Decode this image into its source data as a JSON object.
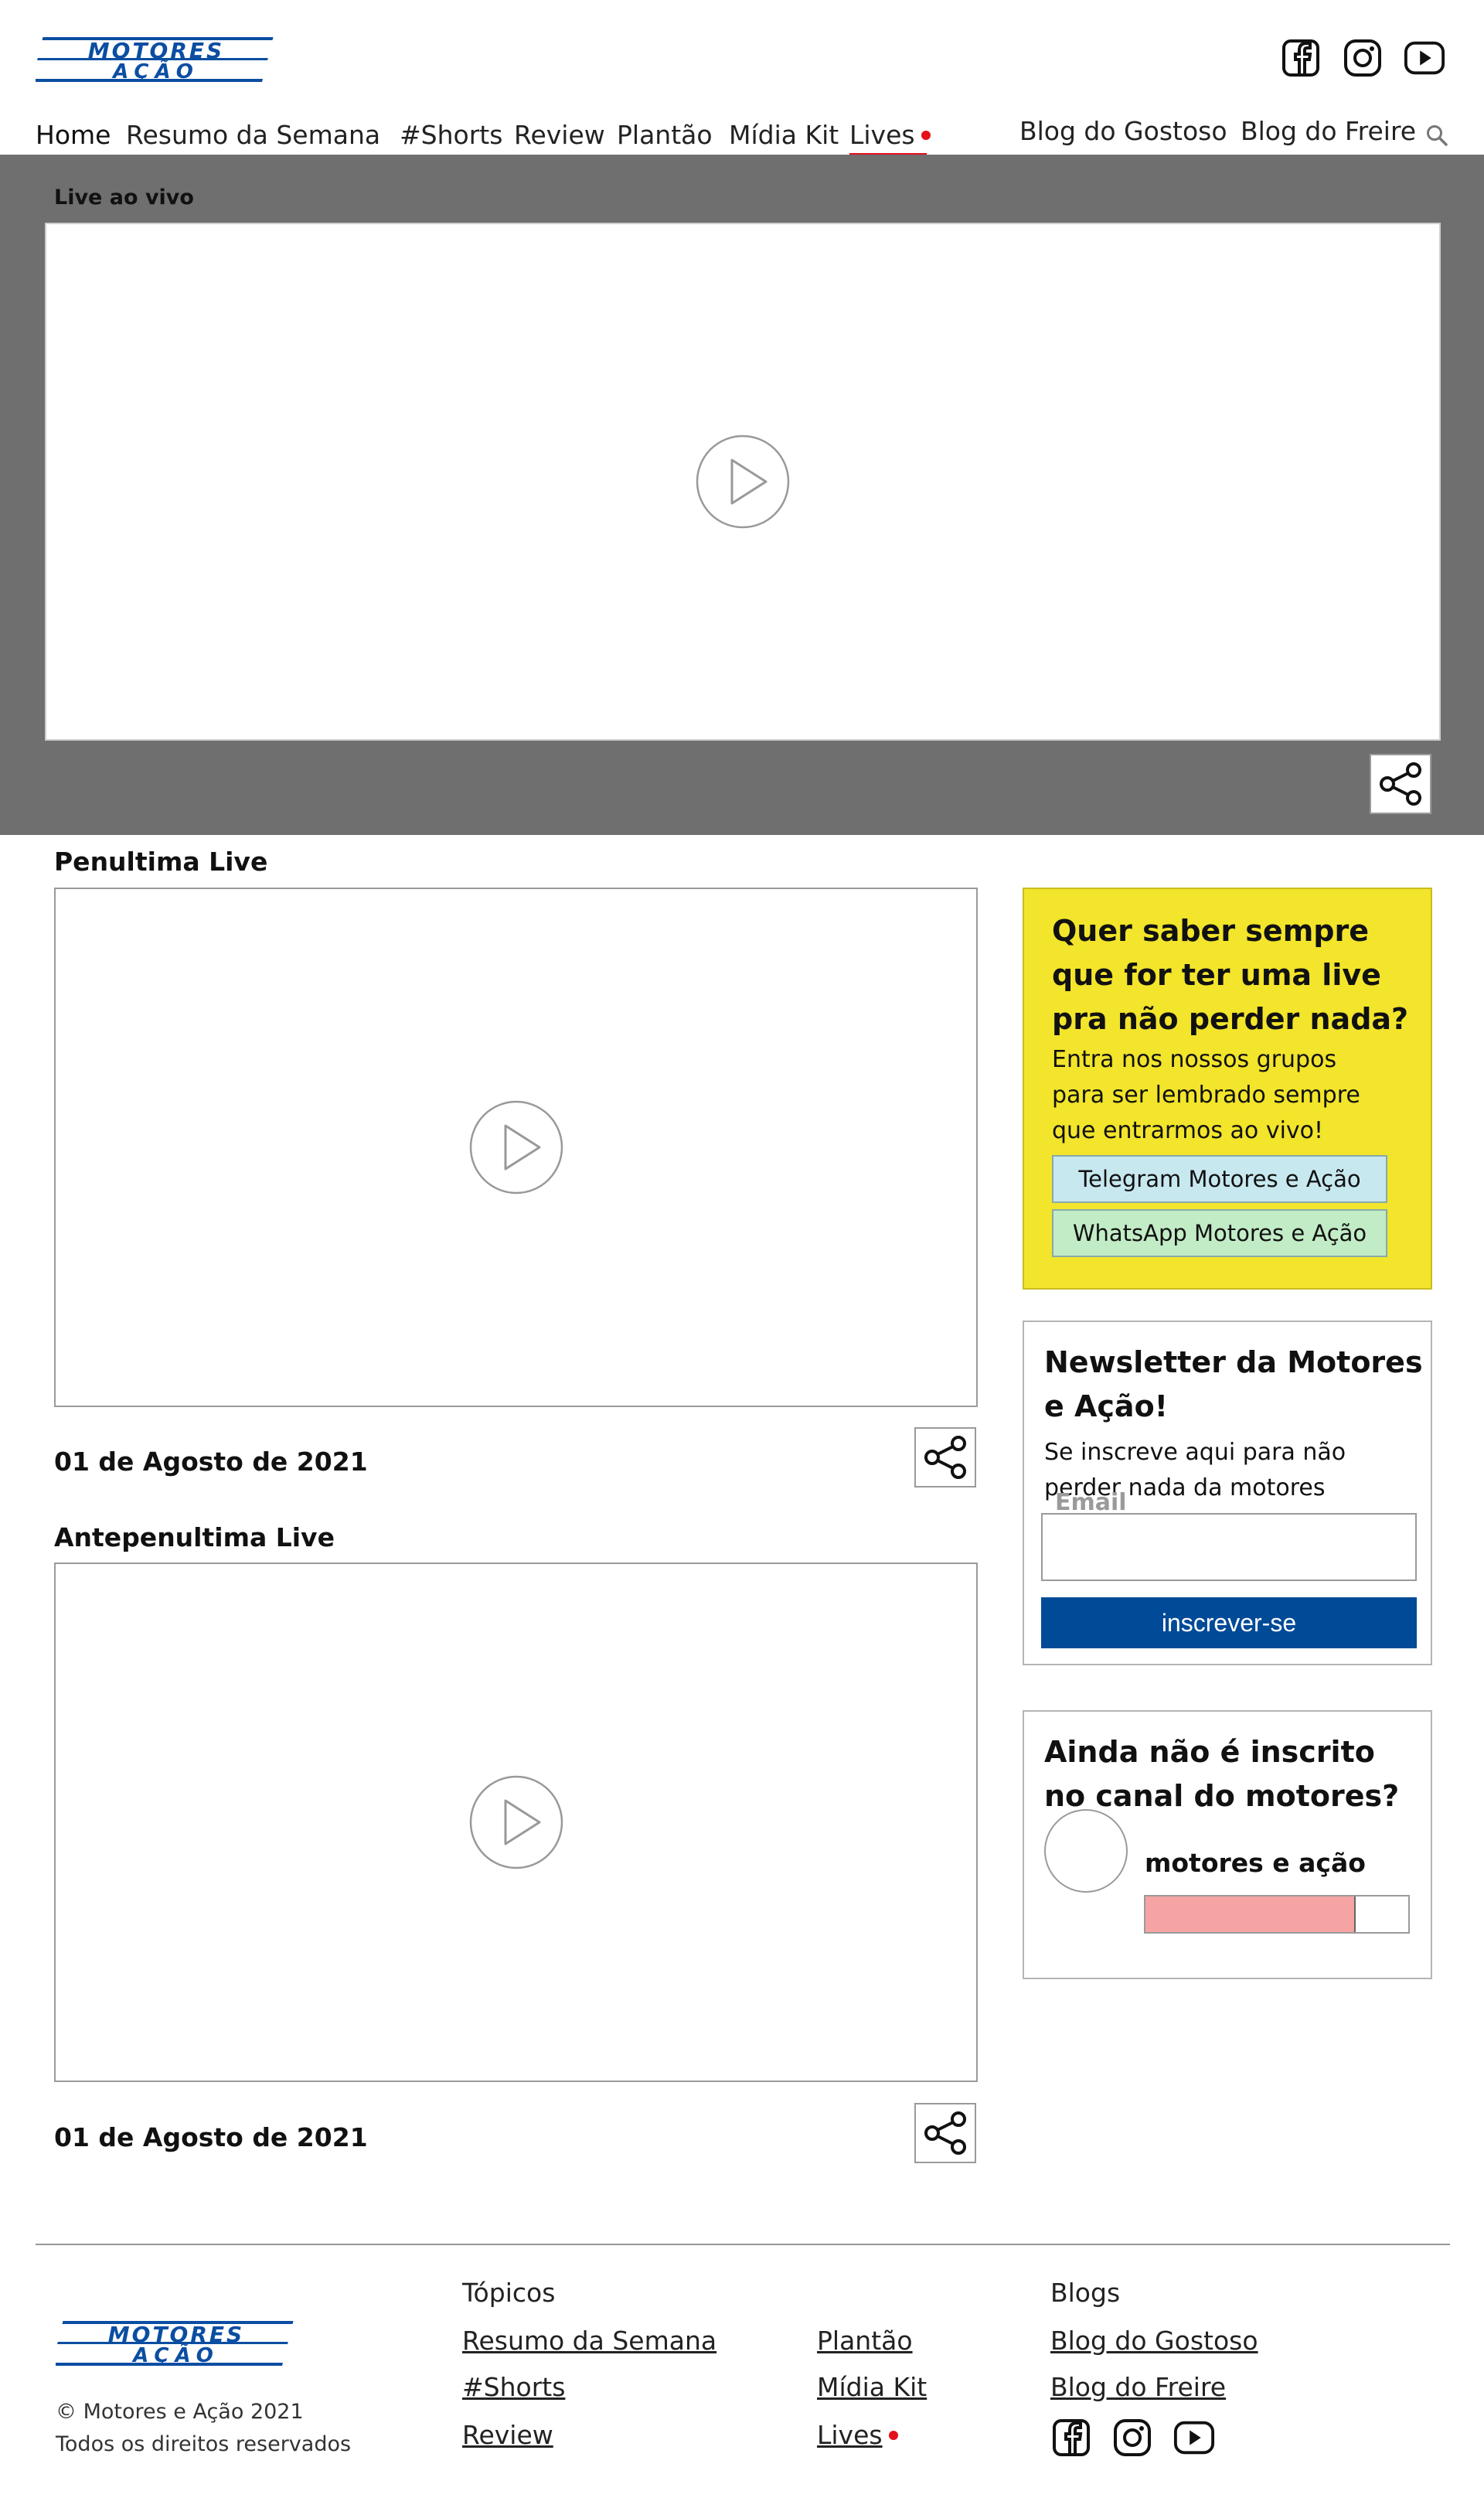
{
  "brand": {
    "logo_line1": "MOTORES",
    "logo_line2": "AÇÃO",
    "color": "#0b4ea2"
  },
  "header": {
    "social": [
      {
        "icon": "facebook-icon"
      },
      {
        "icon": "instagram-icon"
      },
      {
        "icon": "youtube-icon"
      }
    ],
    "nav": [
      {
        "label": "Home"
      },
      {
        "label": "Resumo da Semana"
      },
      {
        "label": "#Shorts"
      },
      {
        "label": "Review"
      },
      {
        "label": "Plantão"
      },
      {
        "label": "Mídia Kit"
      },
      {
        "label": "Lives"
      }
    ],
    "blogs": [
      {
        "label": "Blog do Gostoso"
      },
      {
        "label": "Blog do Freire"
      }
    ],
    "search_icon": "search-icon",
    "live_color": "#e4101a"
  },
  "hero": {
    "label": "Live ao vivo"
  },
  "lives": [
    {
      "title": "Penultima Live",
      "date": "01 de Agosto de 2021"
    },
    {
      "title": "Antepenultima Live",
      "date": "01 de Agosto de 2021"
    }
  ],
  "promo": {
    "title": "Quer saber sempre que for ter uma live pra não perder nada?",
    "text": "Entra nos nossos grupos para ser lembrado sempre que entrarmos ao vivo!",
    "telegram_label": "Telegram Motores e Ação",
    "whatsapp_label": "WhatsApp Motores e Ação",
    "bg_color": "#f2e52b"
  },
  "newsletter": {
    "title": "Newsletter da Motores e Ação!",
    "text": "Se inscreve aqui para não perder nada da motores",
    "email_label": "Email",
    "email_value": "",
    "button_label": "inscrever-se",
    "button_color": "#004a97"
  },
  "channel": {
    "title": "Ainda não é inscrito no canal do motores?",
    "name": "motores e ação",
    "bar_fill": 0.8
  },
  "footer": {
    "topics_heading": "Tópicos",
    "topics_col1": [
      {
        "label": "Resumo da Semana"
      },
      {
        "label": "#Shorts"
      },
      {
        "label": "Review"
      }
    ],
    "topics_col2": [
      {
        "label": "Plantão"
      },
      {
        "label": "Mídia Kit"
      },
      {
        "label": "Lives"
      }
    ],
    "blogs_heading": "Blogs",
    "blogs": [
      {
        "label": "Blog do Gostoso"
      },
      {
        "label": "Blog do Freire"
      }
    ],
    "copyright": "© Motores e Ação 2021",
    "rights": "Todos os direitos reservados"
  }
}
